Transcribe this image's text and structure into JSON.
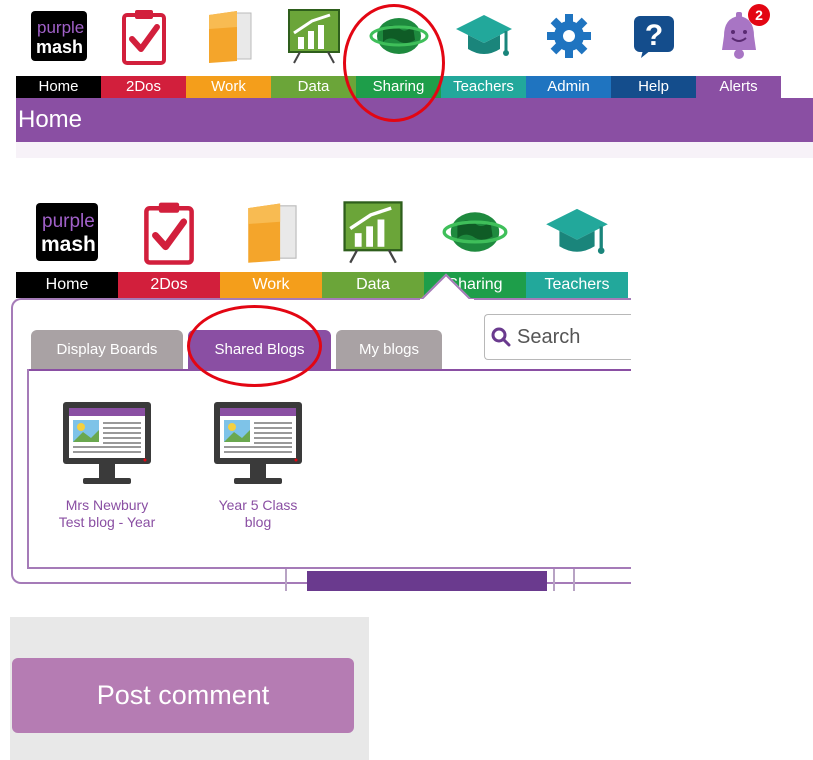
{
  "nav_top": {
    "items": [
      {
        "label": "Home",
        "color": "#000000",
        "icon": "purple-mash-logo-icon"
      },
      {
        "label": "2Dos",
        "color": "#d21f3c",
        "icon": "clipboard-check-icon"
      },
      {
        "label": "Work",
        "color": "#f49e1b",
        "icon": "folder-icon"
      },
      {
        "label": "Data",
        "color": "#6ba539",
        "icon": "chart-board-icon"
      },
      {
        "label": "Sharing",
        "color": "#1e9e4a",
        "icon": "globe-icon"
      },
      {
        "label": "Teachers",
        "color": "#22a89b",
        "icon": "graduation-cap-icon"
      },
      {
        "label": "Admin",
        "color": "#1f74c0",
        "icon": "gear-icon"
      },
      {
        "label": "Help",
        "color": "#144d8c",
        "icon": "question-icon"
      },
      {
        "label": "Alerts",
        "color": "#8a4fa3",
        "icon": "bell-icon"
      }
    ],
    "alerts_badge": "2",
    "logo_text": [
      "purple",
      "mash"
    ]
  },
  "page_title": "Home",
  "nav_second": {
    "items": [
      {
        "label": "Home",
        "color": "#000000"
      },
      {
        "label": "2Dos",
        "color": "#d21f3c"
      },
      {
        "label": "Work",
        "color": "#f49e1b"
      },
      {
        "label": "Data",
        "color": "#6ba539"
      },
      {
        "label": "Sharing",
        "color": "#1e9e4a"
      },
      {
        "label": "Teachers",
        "color": "#22a89b"
      }
    ]
  },
  "sharing_popup": {
    "tabs": [
      "Display Boards",
      "Shared Blogs",
      "My blogs"
    ],
    "active_tab": "Shared Blogs",
    "search_placeholder": "Search",
    "blogs": [
      {
        "title_line1": "Mrs Newbury",
        "title_line2": "Test blog - Year"
      },
      {
        "title_line1": "Year 5 Class",
        "title_line2": "blog"
      }
    ]
  },
  "comment": {
    "button_label": "Post comment"
  },
  "colors": {
    "purple": "#8a4fa3",
    "highlight_circle": "#e30613"
  }
}
